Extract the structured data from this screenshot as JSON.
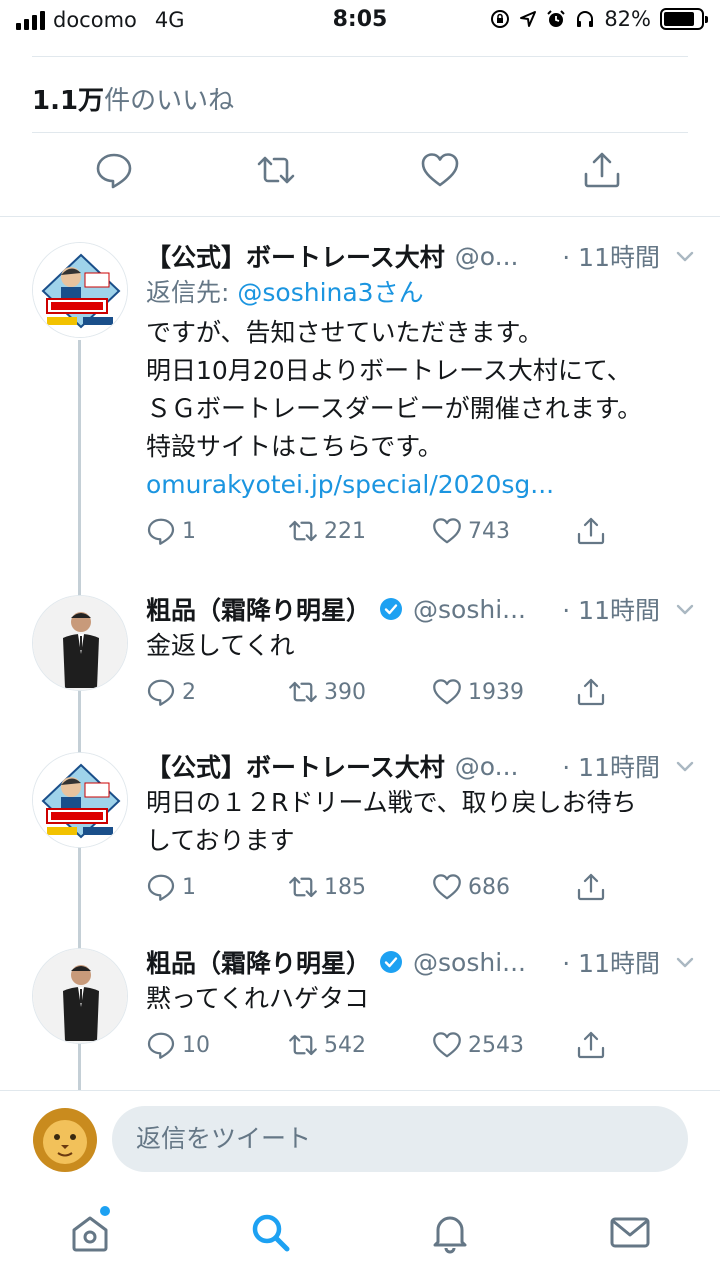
{
  "status_bar": {
    "carrier": "docomo",
    "network": "4G",
    "time": "8:05",
    "battery": "82%",
    "battery_level": 0.82
  },
  "likes": {
    "count": "1.1万",
    "label": "件のいいね"
  },
  "main_actions": [
    "reply-icon",
    "retweet-icon",
    "like-icon",
    "share-icon"
  ],
  "tweets": [
    {
      "name": "【公式】ボートレース大村",
      "handle": "@o...",
      "time": "· 11時間",
      "verified": false,
      "reply_to_label": "返信先: ",
      "reply_to_user": "@soshina3さん",
      "lines": [
        "ですが、告知させていただきます。",
        "明日10月20日よりボートレース大村にて、",
        "ＳＧボートレースダービーが開催されます。",
        "特設サイトはこちらです。"
      ],
      "link": "omurakyotei.jp/special/2020sg...",
      "replies": "1",
      "retweets": "221",
      "likes": "743"
    },
    {
      "name": "粗品（霜降り明星）",
      "handle": "@soshi...",
      "time": "· 11時間",
      "verified": true,
      "lines": [
        "金返してくれ"
      ],
      "replies": "2",
      "retweets": "390",
      "likes": "1939"
    },
    {
      "name": "【公式】ボートレース大村",
      "handle": "@o...",
      "time": "· 11時間",
      "verified": false,
      "lines": [
        "明日の１２Rドリーム戦で、取り戻しお待ち",
        "しております"
      ],
      "replies": "1",
      "retweets": "185",
      "likes": "686"
    },
    {
      "name": "粗品（霜降り明星）",
      "handle": "@soshi...",
      "time": "· 11時間",
      "verified": true,
      "lines": [
        "黙ってくれハゲタコ"
      ],
      "replies": "10",
      "retweets": "542",
      "likes": "2543"
    }
  ],
  "reply_bar": {
    "placeholder": "返信をツイート"
  },
  "tab_bar": {
    "items": [
      "home-icon",
      "search-icon",
      "notifications-icon",
      "messages-icon"
    ],
    "active": "search-icon"
  },
  "colors": {
    "accent": "#1da1f2",
    "link": "#1b95e0",
    "muted": "#657786",
    "verified": "#1da1f2"
  }
}
